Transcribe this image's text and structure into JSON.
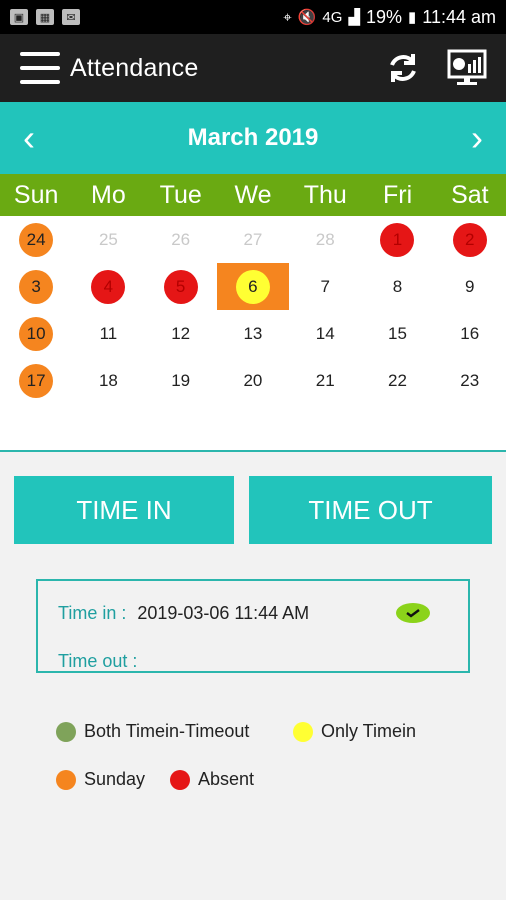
{
  "status": {
    "network": "4G",
    "battery": "19%",
    "time": "11:44 am"
  },
  "appbar": {
    "title": "Attendance"
  },
  "calendar": {
    "month_label": "March 2019",
    "prev_glyph": "‹",
    "next_glyph": "›",
    "weekdays": [
      "Sun",
      "Mo",
      "Tue",
      "We",
      "Thu",
      "Fri",
      "Sat"
    ],
    "weeks": [
      [
        {
          "d": "24",
          "type": "sunday"
        },
        {
          "d": "25",
          "type": "muted"
        },
        {
          "d": "26",
          "type": "muted"
        },
        {
          "d": "27",
          "type": "muted"
        },
        {
          "d": "28",
          "type": "muted"
        },
        {
          "d": "1",
          "type": "absent"
        },
        {
          "d": "2",
          "type": "absent"
        }
      ],
      [
        {
          "d": "3",
          "type": "sunday"
        },
        {
          "d": "4",
          "type": "absent"
        },
        {
          "d": "5",
          "type": "absent"
        },
        {
          "d": "6",
          "type": "today-timein"
        },
        {
          "d": "7",
          "type": "normal"
        },
        {
          "d": "8",
          "type": "normal"
        },
        {
          "d": "9",
          "type": "normal"
        }
      ],
      [
        {
          "d": "10",
          "type": "sunday"
        },
        {
          "d": "11",
          "type": "normal"
        },
        {
          "d": "12",
          "type": "normal"
        },
        {
          "d": "13",
          "type": "normal"
        },
        {
          "d": "14",
          "type": "normal"
        },
        {
          "d": "15",
          "type": "normal"
        },
        {
          "d": "16",
          "type": "normal"
        }
      ],
      [
        {
          "d": "17",
          "type": "sunday"
        },
        {
          "d": "18",
          "type": "normal"
        },
        {
          "d": "19",
          "type": "normal"
        },
        {
          "d": "20",
          "type": "normal"
        },
        {
          "d": "21",
          "type": "normal"
        },
        {
          "d": "22",
          "type": "normal"
        },
        {
          "d": "23",
          "type": "normal"
        }
      ]
    ]
  },
  "buttons": {
    "time_in": "TIME IN",
    "time_out": "TIME OUT"
  },
  "info": {
    "time_in_label": "Time in :",
    "time_in_value": "2019-03-06 11:44 AM",
    "time_out_label": "Time out :",
    "time_out_value": ""
  },
  "legend": {
    "both": "Both Timein-Timeout",
    "only_timein": "Only Timein",
    "sunday": "Sunday",
    "absent": "Absent"
  },
  "colors": {
    "teal": "#22c4bb",
    "green_header": "#6aaa12",
    "orange": "#f5851f",
    "red": "#e51616",
    "yellow": "#ffff33",
    "green_legend": "#7fa35a"
  }
}
